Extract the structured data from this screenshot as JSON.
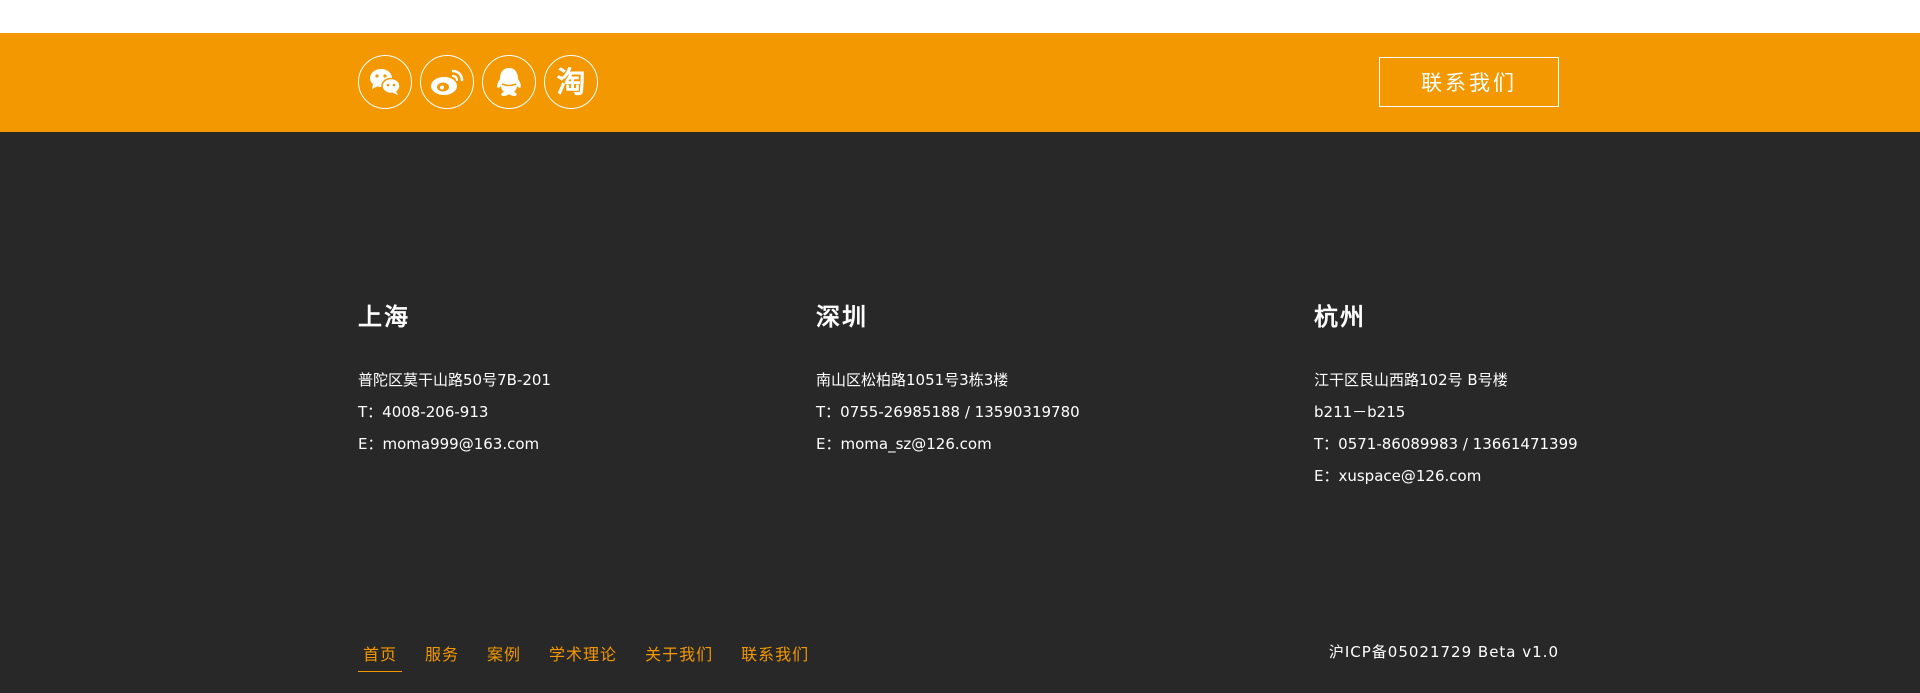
{
  "social": {
    "items": [
      {
        "name": "wechat",
        "icon": "wechat-icon"
      },
      {
        "name": "weibo",
        "icon": "weibo-icon"
      },
      {
        "name": "qq",
        "icon": "qq-icon"
      },
      {
        "name": "taobao",
        "icon": "taobao-icon",
        "glyph": "淘"
      }
    ]
  },
  "contact_button": "联系我们",
  "offices": [
    {
      "city": "上海",
      "lines": [
        "普陀区莫干山路50号7B-201",
        "T：4008-206-913",
        "E：moma999@163.com"
      ]
    },
    {
      "city": "深圳",
      "lines": [
        "南山区松柏路1051号3栋3楼",
        "T：0755-26985188 / 13590319780",
        "E：moma_sz@126.com"
      ]
    },
    {
      "city": "杭州",
      "lines": [
        "江干区艮山西路102号 B号楼",
        "b211－b215",
        "T：0571-86089983 / 13661471399",
        "E：xuspace@126.com"
      ]
    }
  ],
  "nav": {
    "items": [
      {
        "label": "首页",
        "active": true
      },
      {
        "label": "服务"
      },
      {
        "label": "案例"
      },
      {
        "label": "学术理论"
      },
      {
        "label": "关于我们"
      },
      {
        "label": "联系我们"
      }
    ]
  },
  "icp": "沪ICP备05021729 Beta v1.0",
  "colors": {
    "accent": "#f39800",
    "footer_bg": "#282828",
    "text": "#ffffff"
  }
}
